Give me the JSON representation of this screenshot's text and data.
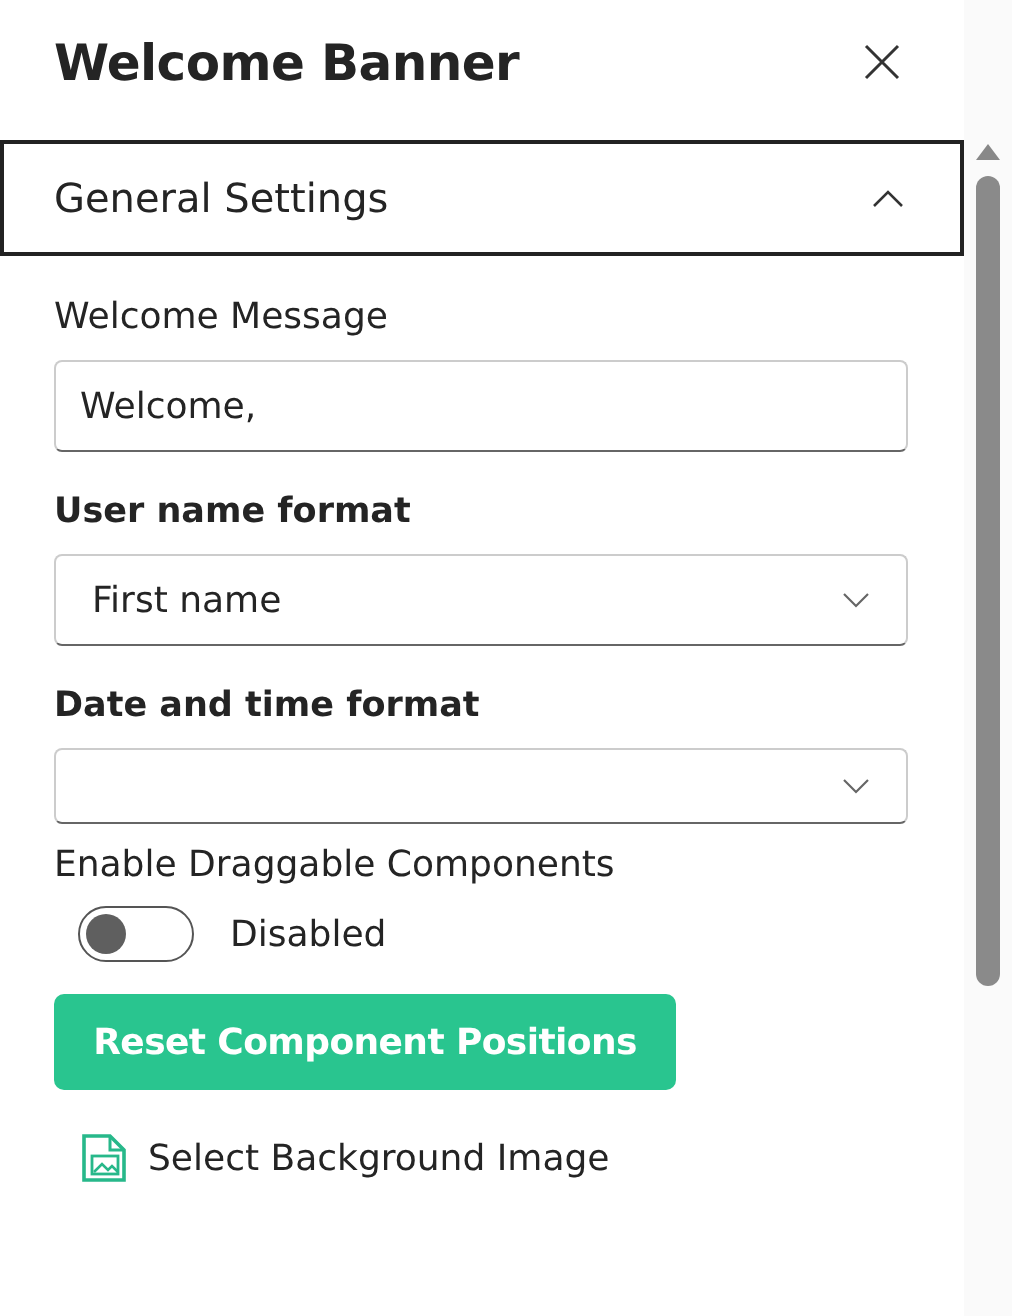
{
  "panel": {
    "title": "Welcome Banner"
  },
  "section": {
    "title": "General Settings",
    "expanded": true
  },
  "fields": [
    {
      "kind": "text",
      "label": "Welcome Message",
      "bold": false,
      "value": "Welcome,"
    },
    {
      "kind": "dropdown",
      "label": "User name format",
      "bold": true,
      "value": "First name"
    },
    {
      "kind": "dropdown",
      "label": "Date and time format",
      "bold": true
    },
    {
      "kind": "toggle",
      "label": "Enable Draggable Components",
      "bold": false,
      "on": false,
      "state_text": "Disabled"
    },
    {
      "kind": "button",
      "label": "Reset Component Positions"
    },
    {
      "kind": "link",
      "label": "Select Background Image"
    }
  ]
}
